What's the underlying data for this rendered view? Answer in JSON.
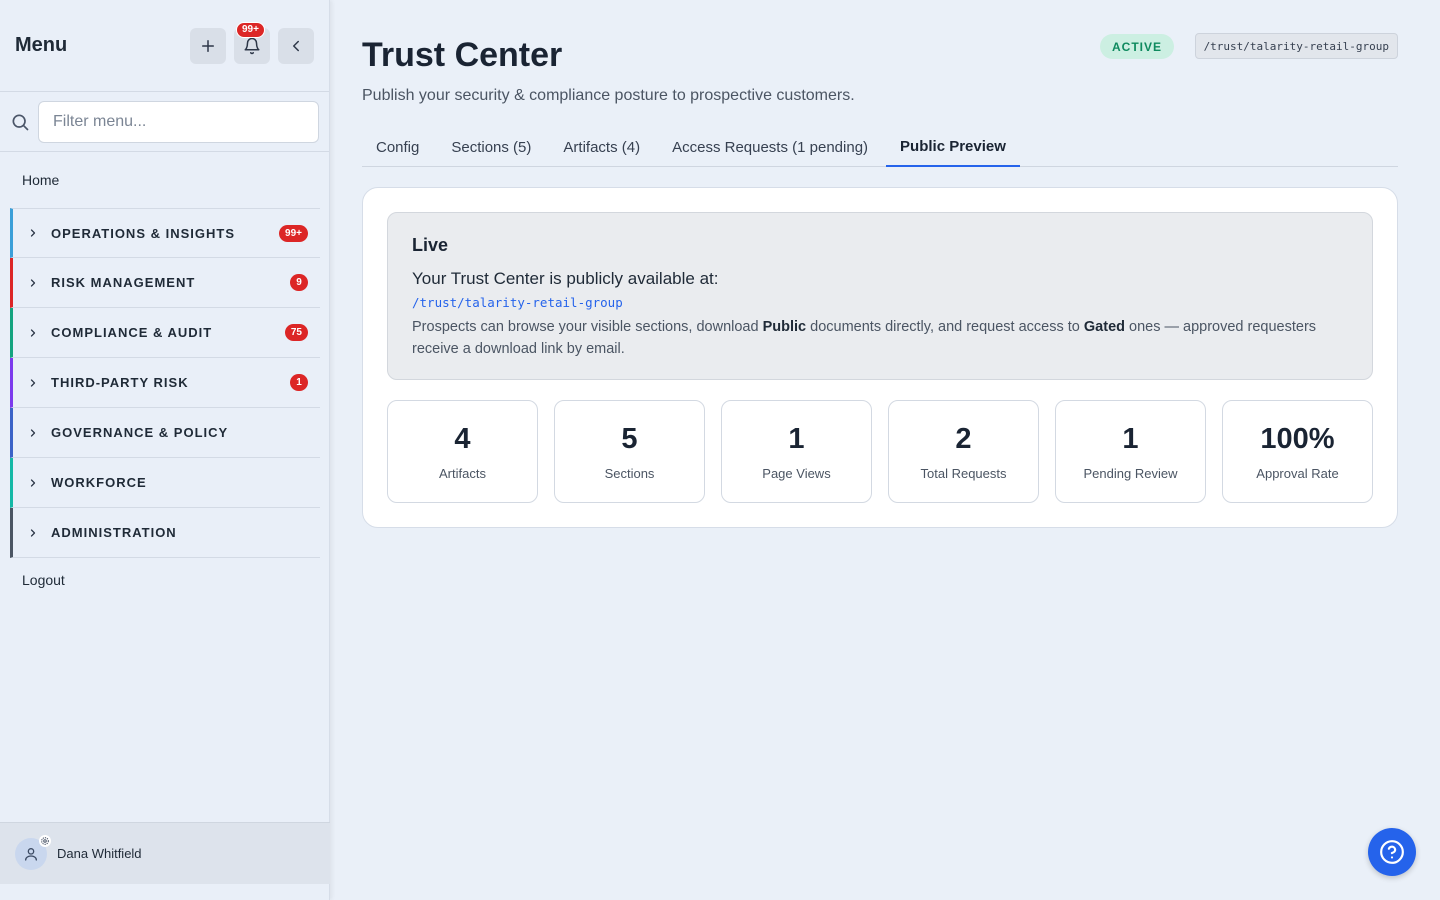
{
  "sidebar": {
    "title": "Menu",
    "notif_count": "99+",
    "search_placeholder": "Filter menu...",
    "home": "Home",
    "groups": [
      {
        "label": "OPERATIONS & INSIGHTS",
        "badge": "99+",
        "color": "#3b9fd8"
      },
      {
        "label": "RISK MANAGEMENT",
        "badge": "9",
        "color": "#dc2626"
      },
      {
        "label": "COMPLIANCE & AUDIT",
        "badge": "75",
        "color": "#14a37f"
      },
      {
        "label": "THIRD-PARTY RISK",
        "badge": "1",
        "color": "#7c3aed"
      },
      {
        "label": "GOVERNANCE & POLICY",
        "badge": "",
        "color": "#3b63c7"
      },
      {
        "label": "WORKFORCE",
        "badge": "",
        "color": "#14b8a6"
      },
      {
        "label": "ADMINISTRATION",
        "badge": "",
        "color": "#4b5563"
      }
    ],
    "logout": "Logout",
    "user_name": "Dana Whitfield"
  },
  "main": {
    "title": "Trust Center",
    "subtitle": "Publish your security & compliance posture to prospective customers.",
    "status": "ACTIVE",
    "path": "/trust/talarity-retail-group",
    "tabs": [
      {
        "label": "Config",
        "active": false
      },
      {
        "label": "Sections (5)",
        "active": false
      },
      {
        "label": "Artifacts (4)",
        "active": false
      },
      {
        "label": "Access Requests (1 pending)",
        "active": false
      },
      {
        "label": "Public Preview",
        "active": true
      }
    ],
    "live": {
      "title": "Live",
      "lead": "Your Trust Center is publicly available at:",
      "url": "/trust/talarity-retail-group",
      "desc_1": "Prospects can browse your visible sections, download ",
      "desc_public": "Public",
      "desc_2": " documents directly, and request access to ",
      "desc_gated": "Gated",
      "desc_3": " ones — approved requesters receive a download link by email."
    },
    "stats": [
      {
        "value": "4",
        "label": "Artifacts"
      },
      {
        "value": "5",
        "label": "Sections"
      },
      {
        "value": "1",
        "label": "Page Views"
      },
      {
        "value": "2",
        "label": "Total Requests"
      },
      {
        "value": "1",
        "label": "Pending Review"
      },
      {
        "value": "100%",
        "label": "Approval Rate"
      }
    ]
  },
  "colors": {
    "accent": "#2563eb",
    "badge_red": "#dc2626",
    "active_green": "#0f8a5f"
  }
}
